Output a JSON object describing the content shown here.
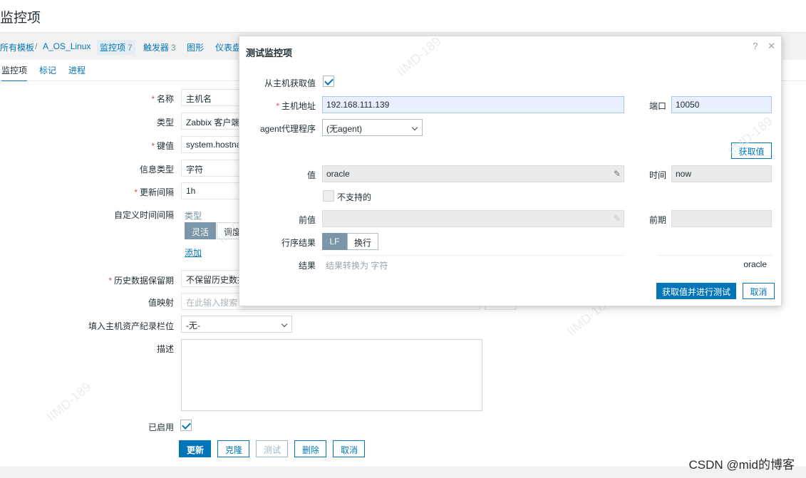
{
  "page": {
    "title": "监控项"
  },
  "breadcrumb": {
    "items": [
      {
        "label": "所有模板"
      },
      {
        "label": "A_OS_Linux"
      },
      {
        "label": "监控项",
        "count": "7"
      },
      {
        "label": "触发器",
        "count": "3"
      },
      {
        "label": "图形"
      },
      {
        "label": "仪表盘"
      }
    ],
    "separator": "/"
  },
  "tabs": [
    {
      "label": "监控项",
      "active": true
    },
    {
      "label": "标记"
    },
    {
      "label": "进程"
    }
  ],
  "form": {
    "name": {
      "label": "名称",
      "value": "主机名"
    },
    "type": {
      "label": "类型",
      "value": "Zabbix 客户端"
    },
    "key": {
      "label": "键值",
      "value": "system.hostnar"
    },
    "info_type": {
      "label": "信息类型",
      "value": "字符"
    },
    "update_interval": {
      "label": "更新间隔",
      "value": "1h"
    },
    "custom_intervals": {
      "label": "自定义时间间隔",
      "type_header": "类型",
      "mode_flexible": "灵活",
      "mode_scheduling": "调度",
      "add_link": "添加"
    },
    "history": {
      "label": "历史数据保留期",
      "value": "不保留历史数据"
    },
    "valuemap": {
      "label": "值映射",
      "placeholder": "在此输入搜索"
    },
    "inventory": {
      "label": "填入主机资产纪录栏位",
      "value": "-无-"
    },
    "description": {
      "label": "描述",
      "value": ""
    },
    "enabled": {
      "label": "已启用",
      "checked": true
    },
    "buttons": {
      "update": "更新",
      "clone": "克隆",
      "test": "测试",
      "delete": "删除",
      "cancel": "取消"
    }
  },
  "modal": {
    "title": "测试监控项",
    "help_icon": "?",
    "close_icon": "✕",
    "get_from_host": {
      "label": "从主机获取值",
      "checked": true
    },
    "host_address": {
      "label": "主机地址",
      "value": "192.168.111.139"
    },
    "port": {
      "label": "端口",
      "value": "10050"
    },
    "proxy": {
      "label": "agent代理程序",
      "value": "(无agent)"
    },
    "get_value_button": "获取值",
    "value": {
      "label": "值",
      "value": "oracle"
    },
    "time": {
      "label": "时间",
      "value": "now"
    },
    "not_supported": {
      "label": "不支持的",
      "checked": false
    },
    "prev_value": {
      "label": "前值",
      "value": ""
    },
    "prev_time": {
      "label": "前期",
      "value": ""
    },
    "eol": {
      "label": "行序结果",
      "lf": "LF",
      "crlf": "换行",
      "selected": "LF"
    },
    "result": {
      "label": "结果",
      "hint": "结果转换为 字符",
      "value": "oracle"
    },
    "buttons": {
      "get_and_test": "获取值并进行测试",
      "cancel": "取消"
    }
  },
  "watermark": {
    "text": "CSDN @mid的博客",
    "overlay": "IIMD-189"
  },
  "colors": {
    "accent": "#0275b8",
    "required": "#d64e4e",
    "segment_active": "#7b96a8",
    "field_blue": "#e8f0fe"
  }
}
